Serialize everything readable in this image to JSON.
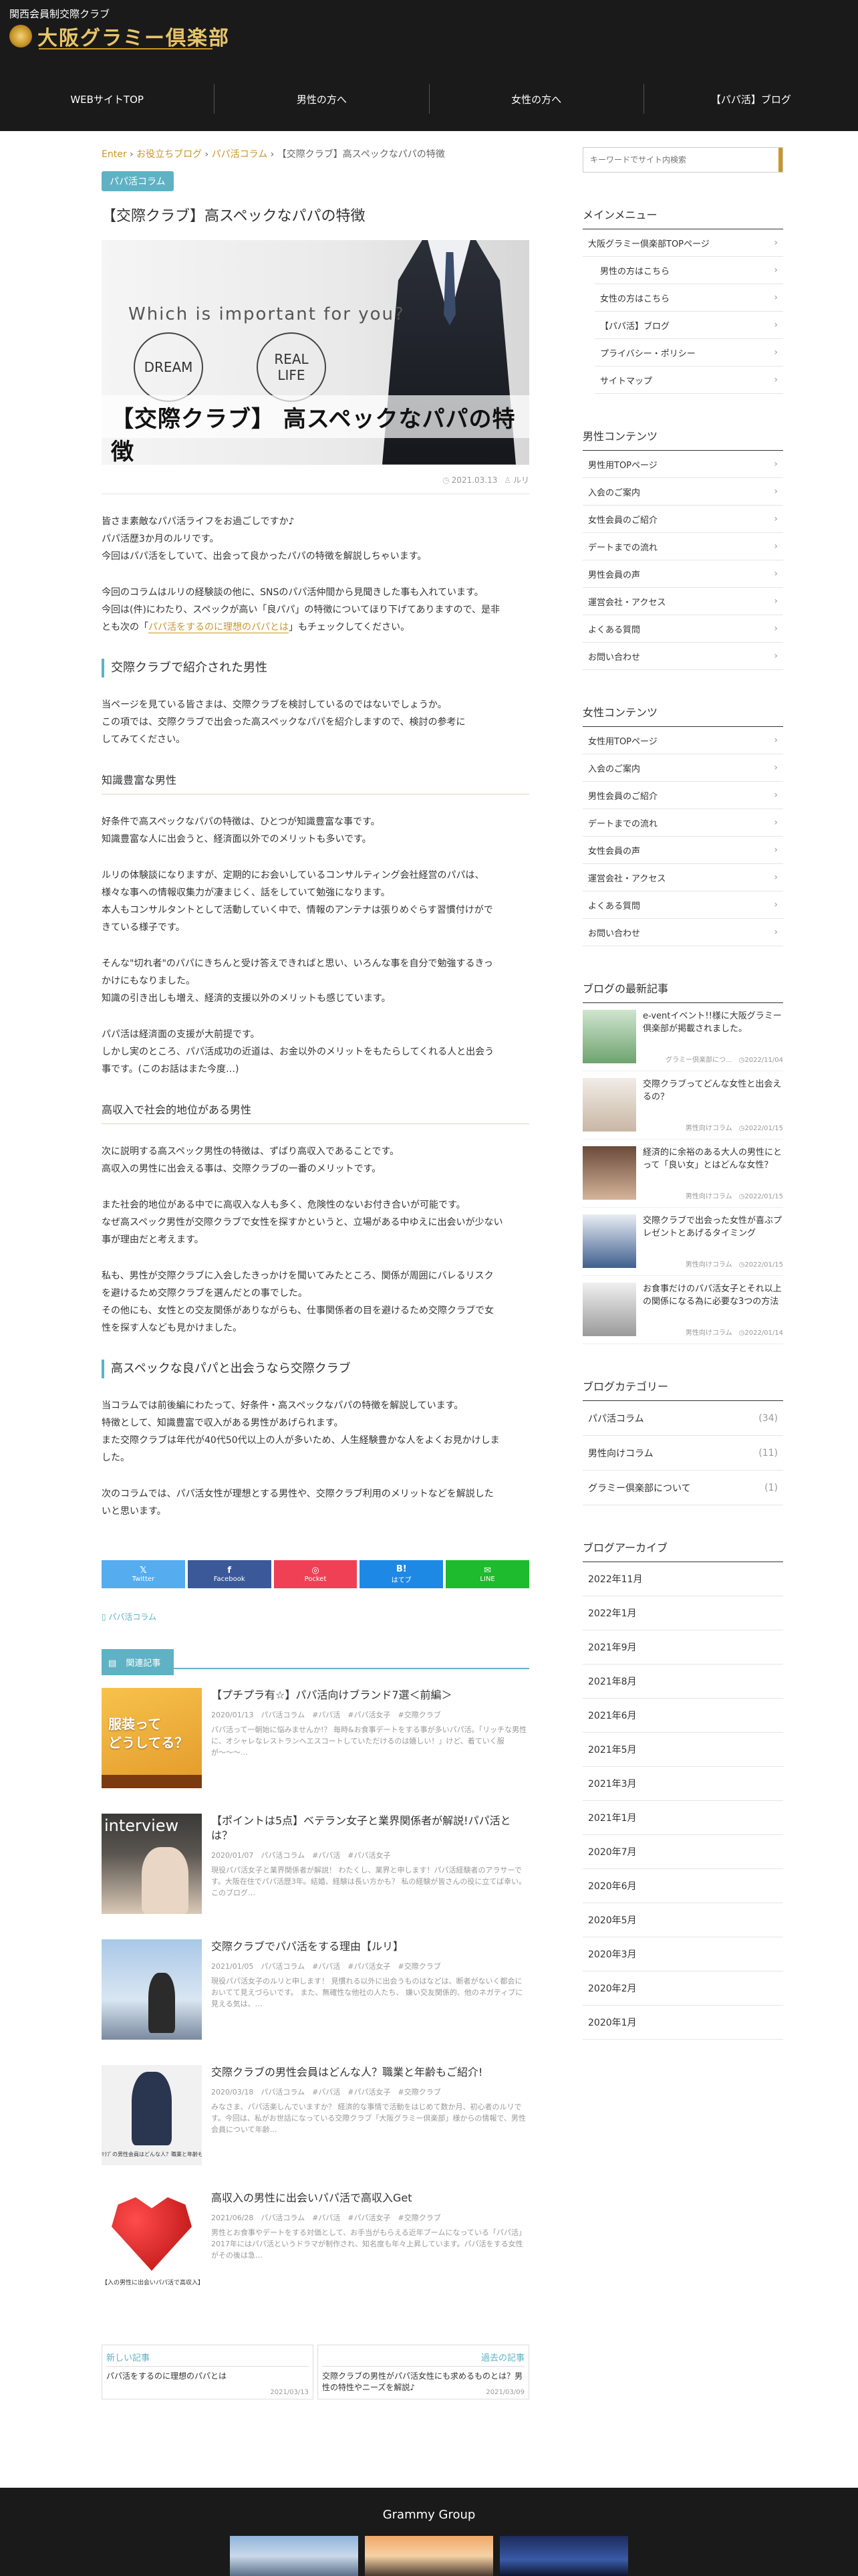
{
  "site": {
    "tagline": "関西会員制交際クラブ",
    "logo_text": "大阪グラミー倶楽部"
  },
  "nav": [
    "WEBサイトTOP",
    "男性の方へ",
    "女性の方へ",
    "【パパ活】ブログ"
  ],
  "breadcrumb": {
    "home": "Enter",
    "sep": "›",
    "level1": "お役立ちブログ",
    "level2": "パパ活コラム",
    "current": "【交際クラブ】高スペックなパパの特徴"
  },
  "article": {
    "category": "パパ活コラム",
    "title": "【交際クラブ】高スペックなパパの特徴",
    "hero": {
      "question": "Which is important for you?",
      "circle1": "DREAM",
      "circle2": "REAL\nLIFE",
      "caption": "【交際クラブ】 高スペックなパパの特徴"
    },
    "date": "2021.03.13",
    "author": "ルリ",
    "intro": [
      "皆さま素敵なパパ活ライフをお過ごしですか♪",
      "パパ活歴3か月のルリです。",
      "今回はパパ活をしていて、出会って良かったパパの特徴を解説しちゃいます。"
    ],
    "intro2": [
      "今回のコラムはルリの経験談の他に、SNSのパパ活仲間から見聞きした事も入れています。",
      "今回は(件)にわたり、スペックが高い「良パパ」の特徴についてほり下げてありますので、是非",
      "とも次の「",
      "パパ活をするのに理想のパパとは",
      "」もチェックしてください。"
    ],
    "h2_1": "交際クラブで紹介された男性",
    "p_h2_1": [
      "当ページを見ている皆さまは、交際クラブを検討しているのではないでしょうか。",
      "この項では、交際クラブで出会った高スペックなパパを紹介しますので、検討の参考に",
      "してみてください。"
    ],
    "h3_1": "知識豊富な男性",
    "p_h3_1a": [
      "好条件で高スペックなパパの特徴は、ひとつが知識豊富な事です。",
      "知識豊富な人に出会うと、経済面以外でのメリットも多いです。"
    ],
    "p_h3_1b": [
      "ルリの体験談になりますが、定期的にお会いしているコンサルティング会社経営のパパは、",
      "様々な事への情報収集力が凄まじく、話をしていて勉強になります。",
      "本人もコンサルタントとして活動していく中で、情報のアンテナは張りめぐらす習慣付けがで",
      "きている様子です。"
    ],
    "p_h3_1c": [
      "そんな\"切れ者\"のパパにきちんと受け答えできればと思い、いろんな事を自分で勉強するきっ",
      "かけにもなりました。",
      "知識の引き出しも増え、経済的支援以外のメリットも感じています。"
    ],
    "p_h3_1d": [
      "パパ活は経済面の支援が大前提です。",
      "しかし実のところ、パパ活成功の近道は、お金以外のメリットをもたらしてくれる人と出会う",
      "事です。(このお話はまた今度…)"
    ],
    "h3_2": "高収入で社会的地位がある男性",
    "p_h3_2a": [
      "次に説明する高スペック男性の特徴は、ずばり高収入であることです。",
      "高収入の男性に出会える事は、交際クラブの一番のメリットです。"
    ],
    "p_h3_2b": [
      "また社会的地位がある中でに高収入な人も多く、危険性のないお付き合いが可能です。",
      "なぜ高スペック男性が交際クラブで女性を探すかというと、立場がある中ゆえに出会いが少ない",
      "事が理由だと考えます。"
    ],
    "p_h3_2c": [
      "私も、男性が交際クラブに入会したきっかけを聞いてみたところ、関係が周囲にバレるリスク",
      "を避けるため交際クラブを選んだとの事でした。",
      "その他にも、女性との交友関係がありながらも、仕事関係者の目を避けるため交際クラブで女",
      "性を探す人なども見かけました。"
    ],
    "h2_2": "高スペックな良パパと出会うなら交際クラブ",
    "p_h2_2a": [
      "当コラムでは前後編にわたって、好条件・高スペックなパパの特徴を解説しています。",
      "特徴として、知識豊富で収入がある男性があげられます。",
      "また交際クラブは年代が40代50代以上の人が多いため、人生経験豊かな人をよくお見かけしま",
      "した。"
    ],
    "p_h2_2b": [
      "次のコラムでは、パパ活女性が理想とする男性や、交際クラブ利用のメリットなどを解説した",
      "いと思います。"
    ],
    "share": [
      {
        "label": "Twitter",
        "color": "#55acee",
        "glyph": "𝕏"
      },
      {
        "label": "Facebook",
        "color": "#3b5998",
        "glyph": "f"
      },
      {
        "label": "Pocket",
        "color": "#ef4056",
        "glyph": "◎"
      },
      {
        "label": "はてブ",
        "color": "#1e88e5",
        "glyph": "B!"
      },
      {
        "label": "LINE",
        "color": "#1dbb2d",
        "glyph": "✉"
      }
    ],
    "tag_link": "パパ活コラム"
  },
  "related": {
    "heading": "関連記事",
    "items": [
      {
        "title": "【プチプラ有☆】パパ活向けブランド7選＜前編＞",
        "meta": "2020/01/13　パパ活コラム　#パパ活　#パパ活女子　#交際クラブ",
        "excerpt": "パパ活って一朝始に悩みませんか!？ 毎時&お食事デートをする事が多いパパ活。「リッチな男性に、オシャレなレストランへエスコートしていただけるのは嬉しい！」けど、着ていく服が〜〜〜…",
        "thumb_text": "服装って\nどうしてる？"
      },
      {
        "title": "【ポイントは5点】ベテラン女子と業界関係者が解説!パパ活とは？",
        "meta": "2020/01/07　パパ活コラム　#パパ活　#パパ活女子",
        "excerpt": "現役パパ活女子と業界関係者が解説！ わたくし、業界と申します！パパ活経験者のアラサーです。大阪在住でパパ活歴3年。結婚、経験は長い方かも？ 私の経験が皆さんの役に立てば幸い。このブログ…",
        "thumb_text": "interview"
      },
      {
        "title": "交際クラブでパパ活をする理由【ルリ】",
        "meta": "2021/01/05　パパ活コラム　#パパ活　#パパ活女子　#交際クラブ",
        "excerpt": "現役パパ活女子のルリと申します！ 見慣れる以外に出会うものはなどは、断者がないく都会においてて見えづらいです。 また、無確性な他社の人たち、 嫌い交友関係的、他のネガティブに見える気は、…",
        "thumb_text": ""
      },
      {
        "title": "交際クラブの男性会員はどんな人？職業と年齢もご紹介!",
        "meta": "2020/03/18　パパ活コラム　#パパ活　#パパ活女子　#交際クラブ",
        "excerpt": "みなさま、パパ活楽しんでいますか？ 経済的な事情で活動をはじめて数か月、初心者のルリです。今回は、私がお世話になっている交際クラブ「大阪グラミー倶楽部」様からの情報で、男性会員について年齢…",
        "thumb_text": "ﾘﾗﾌﾞの男性会員はどんな人？職業と年齢もご"
      },
      {
        "title": "高収入の男性に出会いパパ活で高収入Get",
        "meta": "2021/06/28　パパ活コラム　#パパ活　#パパ活女子　#交際クラブ",
        "excerpt": "男性とお食事やデートをする対価として、お手当がもらえる近年ブームになっている「パパ活」2017年にはパパ活というドラマが制作され、知名度も年々上昇しています。パパ活をする女性がその後は急…",
        "thumb_text": "【入の男性に出会いパパ活で高収入】"
      }
    ]
  },
  "prevnext": {
    "new_label": "新しい記事",
    "new_title": "パパ活をするのに理想のパパとは",
    "new_date": "2021/03/13",
    "old_label": "過去の記事",
    "old_title": "交際クラブの男性がパパ活女性にも求めるものとは？男性の特性やニーズを解説♪",
    "old_date": "2021/03/09"
  },
  "sidebar": {
    "search_placeholder": "キーワードでサイト内検索",
    "main_menu_title": "メインメニュー",
    "main_menu": [
      {
        "label": "大阪グラミー倶楽部TOPページ",
        "indent": false
      },
      {
        "label": "男性の方はこちら",
        "indent": true
      },
      {
        "label": "女性の方はこちら",
        "indent": true
      },
      {
        "label": "【パパ活】ブログ",
        "indent": true
      },
      {
        "label": "プライバシー・ポリシー",
        "indent": true
      },
      {
        "label": "サイトマップ",
        "indent": true
      }
    ],
    "male_title": "男性コンテンツ",
    "male_menu": [
      "男性用TOPページ",
      "入会のご案内",
      "女性会員のご紹介",
      "デートまでの流れ",
      "男性会員の声",
      "運営会社・アクセス",
      "よくある質問",
      "お問い合わせ"
    ],
    "female_title": "女性コンテンツ",
    "female_menu": [
      "女性用TOPページ",
      "入会のご案内",
      "男性会員のご紹介",
      "デートまでの流れ",
      "女性会員の声",
      "運営会社・アクセス",
      "よくある質問",
      "お問い合わせ"
    ],
    "latest_title": "ブログの最新記事",
    "latest": [
      {
        "title": "e-ventイベント!!様に大阪グラミー倶楽部が掲載されました。",
        "cat": "グラミー倶楽部につ...",
        "date": "2022/11/04"
      },
      {
        "title": "交際クラブってどんな女性と出会えるの？",
        "cat": "男性向けコラム",
        "date": "2022/01/15"
      },
      {
        "title": "経済的に余裕のある大人の男性にとって「良い女」とはどんな女性？",
        "cat": "男性向けコラム",
        "date": "2022/01/15"
      },
      {
        "title": "交際クラブで出会った女性が喜ぶプレゼントとあげるタイミング",
        "cat": "男性向けコラム",
        "date": "2022/01/15"
      },
      {
        "title": "お食事だけのパパ活女子とそれ以上の関係になる為に必要な3つの方法",
        "cat": "男性向けコラム",
        "date": "2022/01/14"
      }
    ],
    "category_title": "ブログカテゴリー",
    "categories": [
      {
        "label": "パパ活コラム",
        "count": "(34)"
      },
      {
        "label": "男性向けコラム",
        "count": "(11)"
      },
      {
        "label": "グラミー倶楽部について",
        "count": "(1)"
      }
    ],
    "archive_title": "ブログアーカイブ",
    "archives": [
      "2022年11月",
      "2022年1月",
      "2021年9月",
      "2021年8月",
      "2021年6月",
      "2021年5月",
      "2021年3月",
      "2021年1月",
      "2020年7月",
      "2020年6月",
      "2020年5月",
      "2020年3月",
      "2020年2月",
      "2020年1月"
    ]
  },
  "footer": {
    "title": "Grammy Group"
  },
  "colors": {
    "accent": "#5eb2c4",
    "gold": "#c8962a",
    "dark": "#1a1a1a"
  }
}
